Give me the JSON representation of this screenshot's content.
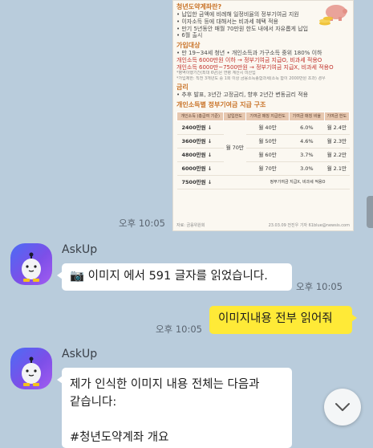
{
  "image_msg": {
    "title": "청년도약계좌란?",
    "intro": [
      "• 납입한 금액에 비례해 일정비율의 정부기여금 지원",
      "• 이자소득 등에 대해서는 비과세 혜택 적용",
      "• 만기 5년동안 매월 70만원 한도 내에서 자유롭게 납입",
      "• 6월 출시"
    ],
    "eligibility_title": "가입대상",
    "eligibility": [
      "• 만 19~34세 청년  • 개인소득과 가구소득 중위 180% 이하",
      "개인소득 6000만원 이하 → 정부기여금 지급O, 비과세 적용O",
      "개인소득 6000만~7500만원 → 정부기여금 지급X, 비과세 적용O"
    ],
    "note1": "*병역이행기간(최대 6년)은 연령 계산시 미산입",
    "note2": "*가입제한: 직전 3개년도 중 1회 이상 금융소득종합과세(소득 합이 2000만원 초과) 경우",
    "rate_title": "금리",
    "rate_text": "• 추후 발표, 3년간 고정금리, 향후 2년간 변동금리 적용",
    "table_title": "개인소득별 정부기여금 지급 구조",
    "table_headers": [
      "개인소득 (총급여 기준)",
      "납입한도",
      "기여금 매칭 지급한도",
      "기여금 매칭 비율",
      "기여금 한도"
    ],
    "table_rows": [
      [
        "2400만원 ↓",
        "월 40만",
        "6.0%",
        "월 2.4만"
      ],
      [
        "3600만원 ↓",
        "월 50만",
        "4.6%",
        "월 2.3만"
      ],
      [
        "4800만원 ↓",
        "월 60만",
        "3.7%",
        "월 2.2만"
      ],
      [
        "6000만원 ↓",
        "월 70만",
        "3.0%",
        "월 2.1만"
      ],
      [
        "7500만원 ↓",
        "정부기여금 지급X, 비과세 적용O",
        "",
        ""
      ]
    ],
    "table_limit": "월 70만",
    "source": "자료: 금융위원회",
    "credit": "23.03.09 전진우 기자 61blue@newsis.com",
    "time": "오후 10:05"
  },
  "bot1": {
    "name": "AskUp",
    "message": "📷 이미지 에서 591 글자를 읽었습니다.",
    "time": "오후 10:05"
  },
  "me1": {
    "message": "이미지내용 전부 읽어줘",
    "time": "오후 10:05"
  },
  "bot2": {
    "name": "AskUp",
    "message_line1": "제가 인식한 이미지 내용 전체는 다음과",
    "message_line2": "같습니다:",
    "message_line3": "#청년도약계좌 개요"
  },
  "colors": {
    "background": "#b9ccdc",
    "my_bubble": "#ffea37",
    "their_bubble": "#ffffff",
    "avatar_gradient": [
      "#4b6cf5",
      "#a35cf0"
    ]
  },
  "icons": [
    "piggy-bank-icon",
    "camera-icon",
    "chevron-down-icon",
    "askup-avatar-icon"
  ]
}
